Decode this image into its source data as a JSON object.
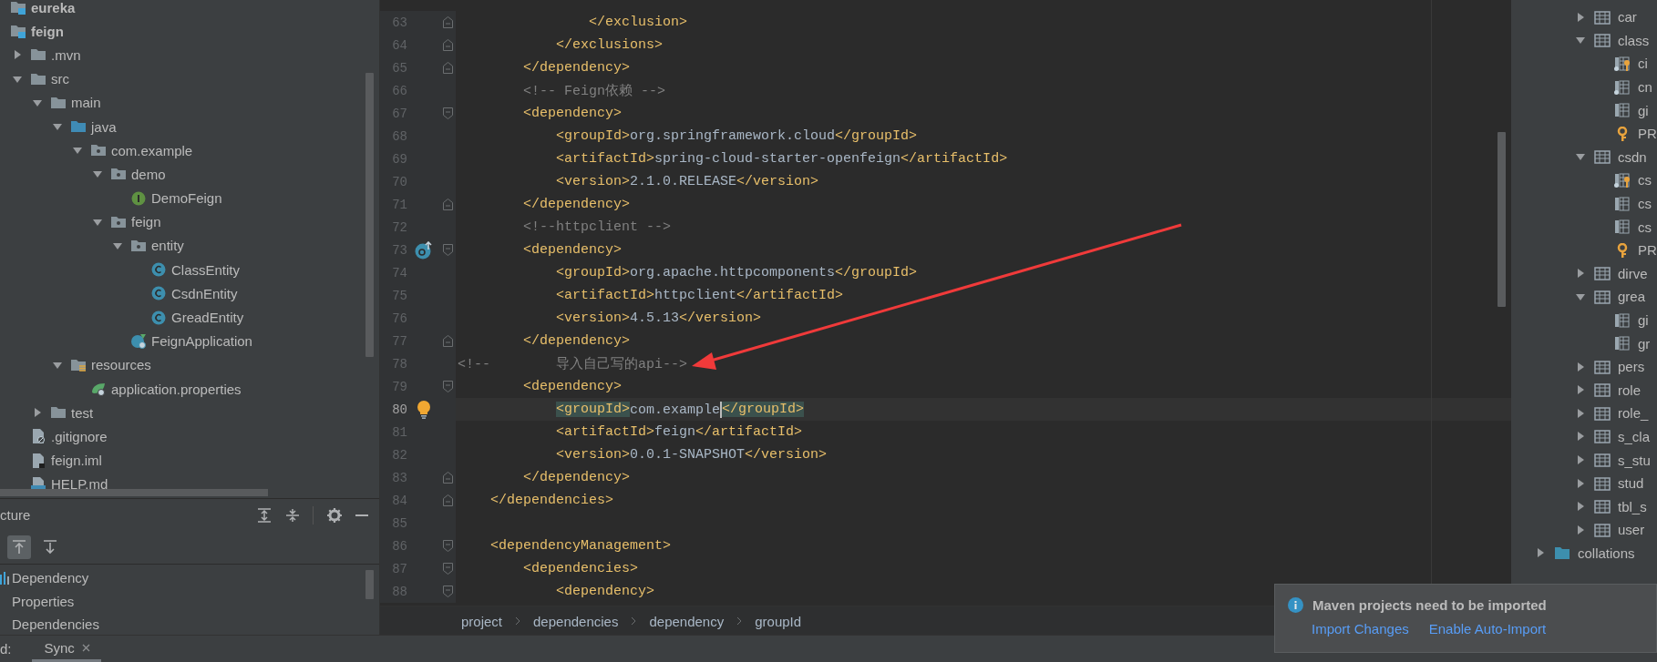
{
  "project_tree": [
    {
      "label": "eureka",
      "kind": "module"
    },
    {
      "label": "feign",
      "kind": "module",
      "children": [
        {
          "label": ".mvn",
          "kind": "folder",
          "expanded": false
        },
        {
          "label": "src",
          "kind": "folder",
          "expanded": true,
          "children": [
            {
              "label": "main",
              "kind": "folder",
              "expanded": true,
              "children": [
                {
                  "label": "java",
                  "kind": "source-folder",
                  "expanded": true,
                  "children": [
                    {
                      "label": "com.example",
                      "kind": "package",
                      "expanded": true,
                      "children": [
                        {
                          "label": "demo",
                          "kind": "package",
                          "expanded": true,
                          "children": [
                            {
                              "label": "DemoFeign",
                              "kind": "interface"
                            }
                          ]
                        },
                        {
                          "label": "feign",
                          "kind": "package",
                          "expanded": true,
                          "children": [
                            {
                              "label": "entity",
                              "kind": "package",
                              "expanded": true,
                              "children": [
                                {
                                  "label": "ClassEntity",
                                  "kind": "class"
                                },
                                {
                                  "label": "CsdnEntity",
                                  "kind": "class"
                                },
                                {
                                  "label": "GreadEntity",
                                  "kind": "class"
                                }
                              ]
                            },
                            {
                              "label": "FeignApplication",
                              "kind": "spring-class"
                            }
                          ]
                        }
                      ]
                    }
                  ]
                },
                {
                  "label": "resources",
                  "kind": "resources-folder",
                  "expanded": true,
                  "children": [
                    {
                      "label": "application.properties",
                      "kind": "spring-properties"
                    }
                  ]
                }
              ]
            },
            {
              "label": "test",
              "kind": "folder",
              "expanded": false
            }
          ]
        },
        {
          "label": ".gitignore",
          "kind": "ignore-file"
        },
        {
          "label": "feign.iml",
          "kind": "iml-file"
        },
        {
          "label": "HELP.md",
          "kind": "md-file"
        }
      ]
    }
  ],
  "structure": {
    "title": "cture",
    "toolbar": [
      {
        "kind": "up",
        "selected": true
      },
      {
        "kind": "down",
        "selected": false
      }
    ],
    "items": [
      {
        "label": "Dependency",
        "kind": "bars"
      },
      {
        "label": "Properties",
        "kind": "plain"
      },
      {
        "label": "Dependencies",
        "kind": "plain"
      }
    ]
  },
  "editor": {
    "lines": [
      {
        "number": "63",
        "kind": "code",
        "text": "                </exclusion>",
        "fold": {
          "kind": "close"
        }
      },
      {
        "number": "64",
        "kind": "code",
        "text": "            </exclusions>",
        "fold": {
          "kind": "close"
        }
      },
      {
        "number": "65",
        "kind": "code",
        "text": "        </dependency>",
        "fold": {
          "kind": "close"
        }
      },
      {
        "number": "66",
        "kind": "comment",
        "text": "        <!-- Feign依赖 -->"
      },
      {
        "number": "67",
        "kind": "code",
        "text": "        <dependency>",
        "fold": {
          "kind": "open"
        }
      },
      {
        "number": "68",
        "kind": "code",
        "text": "            <groupId>org.springframework.cloud</groupId>"
      },
      {
        "number": "69",
        "kind": "code",
        "text": "            <artifactId>spring-cloud-starter-openfeign</artifactId>"
      },
      {
        "number": "70",
        "kind": "code",
        "text": "            <version>2.1.0.RELEASE</version>"
      },
      {
        "number": "71",
        "kind": "code",
        "text": "        </dependency>",
        "fold": {
          "kind": "close"
        }
      },
      {
        "number": "72",
        "kind": "comment",
        "text": "        <!--httpclient -->"
      },
      {
        "number": "73",
        "kind": "code",
        "text": "        <dependency>",
        "fold": {
          "kind": "open"
        },
        "marker": {
          "kind": "maven"
        }
      },
      {
        "number": "74",
        "kind": "code",
        "text": "            <groupId>org.apache.httpcomponents</groupId>"
      },
      {
        "number": "75",
        "kind": "code",
        "text": "            <artifactId>httpclient</artifactId>"
      },
      {
        "number": "76",
        "kind": "code",
        "text": "            <version>4.5.13</version>"
      },
      {
        "number": "77",
        "kind": "code",
        "text": "        </dependency>",
        "fold": {
          "kind": "close"
        }
      },
      {
        "number": "78",
        "kind": "comment",
        "text": "<!--        导入自己写的api-->"
      },
      {
        "number": "79",
        "kind": "code",
        "text": "        <dependency>",
        "fold": {
          "kind": "open"
        }
      },
      {
        "number": "80",
        "kind": "code",
        "text": "            <groupId>com.example</groupId>",
        "marker": {
          "kind": "bulb"
        },
        "current": true
      },
      {
        "number": "81",
        "kind": "code",
        "text": "            <artifactId>feign</artifactId>"
      },
      {
        "number": "82",
        "kind": "code",
        "text": "            <version>0.0.1-SNAPSHOT</version>"
      },
      {
        "number": "83",
        "kind": "code",
        "text": "        </dependency>",
        "fold": {
          "kind": "close"
        }
      },
      {
        "number": "84",
        "kind": "code",
        "text": "    </dependencies>",
        "fold": {
          "kind": "close"
        }
      },
      {
        "number": "85"
      },
      {
        "number": "86",
        "kind": "code",
        "text": "    <dependencyManagement>",
        "fold": {
          "kind": "open"
        }
      },
      {
        "number": "87",
        "kind": "code",
        "text": "        <dependencies>",
        "fold": {
          "kind": "open"
        }
      },
      {
        "number": "88",
        "kind": "code",
        "text": "            <dependency>",
        "fold": {
          "kind": "open"
        }
      }
    ],
    "breadcrumbs": [
      "project",
      "dependencies",
      "dependency",
      "groupId"
    ]
  },
  "database_tree": {
    "tables": [
      {
        "label": "car",
        "kind": "table",
        "expanded": false
      },
      {
        "label": "class",
        "kind": "table",
        "expanded": true,
        "children": [
          {
            "label": "ci",
            "kind": "primary-column"
          },
          {
            "label": "cn",
            "kind": "index-column"
          },
          {
            "label": "gi",
            "kind": "column"
          },
          {
            "label": "PR",
            "kind": "key"
          }
        ]
      },
      {
        "label": "csdn",
        "kind": "table",
        "expanded": true,
        "children": [
          {
            "label": "cs",
            "kind": "primary-column"
          },
          {
            "label": "cs",
            "kind": "column"
          },
          {
            "label": "cs",
            "kind": "column"
          },
          {
            "label": "PR",
            "kind": "key"
          }
        ]
      },
      {
        "label": "dirve",
        "kind": "table",
        "expanded": false
      },
      {
        "label": "grea",
        "kind": "table",
        "expanded": true,
        "children": [
          {
            "label": "gi",
            "kind": "column"
          },
          {
            "label": "gr",
            "kind": "column"
          }
        ]
      },
      {
        "label": "pers",
        "kind": "table",
        "expanded": false
      },
      {
        "label": "role",
        "kind": "table",
        "expanded": false
      },
      {
        "label": "role_",
        "kind": "table",
        "expanded": false
      },
      {
        "label": "s_cla",
        "kind": "table",
        "expanded": false
      },
      {
        "label": "s_stu",
        "kind": "table",
        "expanded": false
      },
      {
        "label": "stud",
        "kind": "table",
        "expanded": false
      },
      {
        "label": "tbl_s",
        "kind": "table",
        "expanded": false
      },
      {
        "label": "user",
        "kind": "table",
        "expanded": false
      }
    ],
    "others": [
      {
        "label": "collations",
        "kind": "folder",
        "expanded": false
      }
    ]
  },
  "bottom_bar": {
    "label": "d:",
    "tabs": [
      {
        "label": "Sync",
        "selected": true
      }
    ]
  },
  "notification": {
    "title": "Maven projects need to be imported",
    "links": [
      "Import Changes",
      "Enable Auto-Import"
    ]
  }
}
